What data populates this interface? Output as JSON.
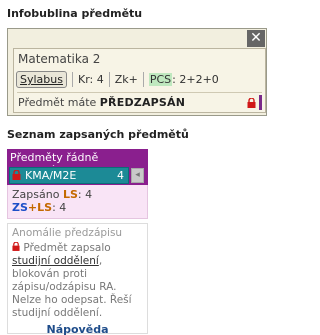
{
  "infobubble": {
    "heading": "Infobublina předmětu",
    "close_label": "✕",
    "subject_title": "Matematika 2",
    "syllabus_label": "Sylabus",
    "credits": "Kr: 4",
    "completion": "Zk+",
    "pcs_label": "PCS",
    "pcs_value": ": 2+2+0",
    "status_prefix": "Předmět máte ",
    "status_value": "PŘEDZAPSÁN",
    "status_color": "#7a2a8a"
  },
  "enrolled": {
    "heading": "Seznam zapsaných předmětů",
    "panel_title": "Předměty řádně zapsané",
    "subject_code": "KMA/M2E",
    "subject_count": "4",
    "zapsano_label": "Zapsáno ",
    "zapsano_ls": "LS",
    "zapsano_value": ": 4",
    "zs_label": "ZS",
    "plus": "+",
    "ls_label": "LS",
    "zs_ls_value": ": 4",
    "accent": "#8a1f8e"
  },
  "anomalies": {
    "title": "Anomálie předzápisu",
    "text_before": "Předmět zapsalo ",
    "link_text": "studijní oddělení",
    "text_after": ", blokován proti zápisu/odzápisu RA. Nelze ho odepsat. Řeší studijní oddělení.",
    "help_label": "Nápověda"
  }
}
